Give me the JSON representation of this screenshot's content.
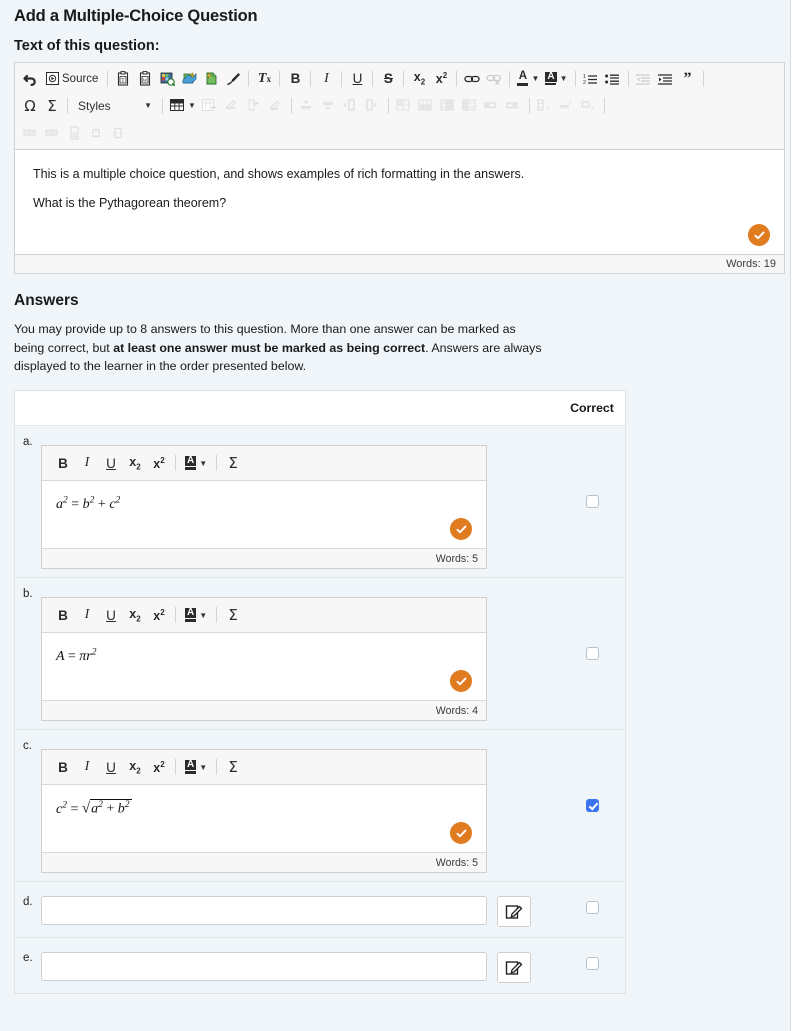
{
  "header": {
    "title": "Add a Multiple-Choice Question",
    "question_label": "Text of this question:"
  },
  "main_editor": {
    "toolbar_rows": [
      [
        {
          "name": "undo-icon",
          "glyph": "undo",
          "label": "",
          "dim": false
        },
        {
          "name": "source-button",
          "glyph": "source",
          "label": "Source",
          "dim": false
        },
        {
          "name": "sep",
          "glyph": "sep"
        },
        {
          "name": "paste-text-icon",
          "glyph": "paste-text",
          "dim": false
        },
        {
          "name": "paste-word-icon",
          "glyph": "paste-word",
          "dim": false
        },
        {
          "name": "insert-image-icon",
          "glyph": "image",
          "dim": false
        },
        {
          "name": "insert-media-icon",
          "glyph": "media",
          "dim": false
        },
        {
          "name": "insert-file-icon",
          "glyph": "file",
          "dim": false
        },
        {
          "name": "format-painter-icon",
          "glyph": "brush",
          "dim": false
        },
        {
          "name": "sep",
          "glyph": "sep"
        },
        {
          "name": "remove-format-icon",
          "glyph": "Tx",
          "dim": false
        },
        {
          "name": "sep",
          "glyph": "sep"
        },
        {
          "name": "bold-icon",
          "glyph": "B",
          "dim": false
        },
        {
          "name": "sep",
          "glyph": "sep"
        },
        {
          "name": "italic-icon",
          "glyph": "I",
          "dim": false
        },
        {
          "name": "sep",
          "glyph": "sep"
        },
        {
          "name": "underline-icon",
          "glyph": "U",
          "dim": false
        },
        {
          "name": "sep",
          "glyph": "sep"
        },
        {
          "name": "strikethrough-icon",
          "glyph": "S",
          "dim": false
        },
        {
          "name": "sep",
          "glyph": "sep"
        },
        {
          "name": "subscript-icon",
          "glyph": "x2sub",
          "dim": false
        },
        {
          "name": "superscript-icon",
          "glyph": "x2sup",
          "dim": false
        },
        {
          "name": "sep",
          "glyph": "sep"
        },
        {
          "name": "link-icon",
          "glyph": "link",
          "dim": false
        },
        {
          "name": "unlink-icon",
          "glyph": "unlink",
          "dim": true
        },
        {
          "name": "sep",
          "glyph": "sep"
        },
        {
          "name": "text-color-icon",
          "glyph": "text-color",
          "dim": false
        },
        {
          "name": "background-color-icon",
          "glyph": "bg-color",
          "dim": false
        },
        {
          "name": "sep",
          "glyph": "sep"
        },
        {
          "name": "numbered-list-icon",
          "glyph": "ol",
          "dim": false
        },
        {
          "name": "bulleted-list-icon",
          "glyph": "ul",
          "dim": false
        },
        {
          "name": "sep",
          "glyph": "sep"
        },
        {
          "name": "decrease-indent-icon",
          "glyph": "outdent",
          "dim": true
        },
        {
          "name": "increase-indent-icon",
          "glyph": "indent",
          "dim": false
        },
        {
          "name": "blockquote-icon",
          "glyph": "quote",
          "dim": false
        },
        {
          "name": "sep",
          "glyph": "sep"
        }
      ],
      [
        {
          "name": "special-character-icon",
          "glyph": "omega",
          "dim": false
        },
        {
          "name": "insert-equation-icon",
          "glyph": "sigma",
          "dim": false
        },
        {
          "name": "sep",
          "glyph": "sep"
        },
        {
          "name": "styles-dropdown",
          "glyph": "styles",
          "label": "Styles",
          "dim": false
        },
        {
          "name": "sep",
          "glyph": "sep"
        },
        {
          "name": "insert-table-icon",
          "glyph": "table",
          "dim": false
        },
        {
          "name": "table-properties-icon",
          "glyph": "tbl-prop",
          "dim": true
        },
        {
          "name": "delete-table-icon",
          "glyph": "tbl-del",
          "dim": true
        },
        {
          "name": "cell-properties-icon",
          "glyph": "cell-prop",
          "dim": true
        },
        {
          "name": "delete-cell-icon",
          "glyph": "cell-del",
          "dim": true
        },
        {
          "name": "sep",
          "glyph": "sep"
        },
        {
          "name": "insert-row-before-icon",
          "glyph": "row-before",
          "dim": true
        },
        {
          "name": "insert-row-after-icon",
          "glyph": "row-after",
          "dim": true
        },
        {
          "name": "insert-column-left-icon",
          "glyph": "col-left",
          "dim": true
        },
        {
          "name": "insert-column-right-icon",
          "glyph": "col-right",
          "dim": true
        },
        {
          "name": "sep",
          "glyph": "sep"
        },
        {
          "name": "merge-cells-icon",
          "glyph": "merge1",
          "dim": true
        },
        {
          "name": "merge-right-icon",
          "glyph": "merge2",
          "dim": true
        },
        {
          "name": "merge-down-icon",
          "glyph": "merge3",
          "dim": true
        },
        {
          "name": "split-cell-icon",
          "glyph": "merge4",
          "dim": true
        },
        {
          "name": "insert-caption-icon",
          "glyph": "cap1",
          "dim": true
        },
        {
          "name": "insert-summary-icon",
          "glyph": "cap2",
          "dim": true
        },
        {
          "name": "sep",
          "glyph": "sep"
        },
        {
          "name": "delete-row-icon",
          "glyph": "del-row",
          "dim": true
        },
        {
          "name": "delete-column-icon",
          "glyph": "del-col",
          "dim": true
        },
        {
          "name": "delete-cell2-icon",
          "glyph": "del-cell",
          "dim": true
        },
        {
          "name": "sep",
          "glyph": "sep"
        }
      ],
      [
        {
          "name": "split-cell-horizontal-icon",
          "glyph": "sp-h",
          "dim": true
        },
        {
          "name": "split-cell-vertical-icon",
          "glyph": "sp-v",
          "dim": true
        },
        {
          "name": "cell-height-icon",
          "glyph": "cell-h",
          "dim": true
        },
        {
          "name": "align-cell-center-icon",
          "glyph": "al-c",
          "dim": true
        },
        {
          "name": "align-cell-middle-icon",
          "glyph": "al-m",
          "dim": true
        }
      ]
    ],
    "source_label": "Source",
    "styles_label": "Styles",
    "paragraphs": [
      "This is a multiple choice question, and shows examples of rich formatting in the answers.",
      "What is the Pythagorean theorem?"
    ],
    "word_count": "Words: 19",
    "accessibility_badge": "accessibility-check-icon"
  },
  "answers": {
    "heading": "Answers",
    "description_part1": "You may provide up to 8 answers to this question. More than one answer can be marked as being correct, but ",
    "description_bold": "at least one answer must be marked as being correct",
    "description_part2": ". Answers are always displayed to the learner in the order presented below.",
    "correct_column_header": "Correct",
    "mini_toolbar": [
      {
        "name": "bold-icon",
        "glyph": "B"
      },
      {
        "name": "italic-icon",
        "glyph": "I"
      },
      {
        "name": "underline-icon",
        "glyph": "U"
      },
      {
        "name": "subscript-icon",
        "glyph": "x2sub"
      },
      {
        "name": "superscript-icon",
        "glyph": "x2sup"
      },
      {
        "name": "sep",
        "glyph": "sep"
      },
      {
        "name": "background-color-icon",
        "glyph": "bg-color"
      },
      {
        "name": "sep",
        "glyph": "sep"
      },
      {
        "name": "insert-equation-icon",
        "glyph": "sigma"
      }
    ],
    "rows": [
      {
        "letter": "a.",
        "type": "editor",
        "formula_html": "<span class=\"math\"><i>a</i><sup>2</sup> <span class=\"op\">=</span> <i>b</i><sup>2</sup> <span class=\"op\">+</span> <i>c</i><sup>2</sup></span>",
        "word_count": "Words: 5",
        "correct": false,
        "accessibility_badge": "accessibility-check-icon"
      },
      {
        "letter": "b.",
        "type": "editor",
        "formula_html": "<span class=\"math\"><i>A</i> <span class=\"op\">=</span> <i>&pi;r</i><sup>2</sup></span>",
        "word_count": "Words: 4",
        "correct": false,
        "accessibility_badge": "accessibility-check-icon"
      },
      {
        "letter": "c.",
        "type": "editor",
        "formula_html": "<span class=\"math\"><i>c</i><sup>2</sup> <span class=\"op\">=</span> <span class=\"sqrt\"><span class=\"radsign\">&radic;</span><span class=\"radicand\"><i>a</i><sup>2</sup> <span class=\"op\">+</span> <i>b</i><sup>2</sup></span></span></span>",
        "word_count": "Words: 5",
        "correct": true,
        "accessibility_badge": "accessibility-check-icon"
      },
      {
        "letter": "d.",
        "type": "input",
        "value": "",
        "placeholder": "",
        "edit_button": "open-editor-icon",
        "correct": false
      },
      {
        "letter": "e.",
        "type": "input",
        "value": "",
        "placeholder": "",
        "edit_button": "open-editor-icon",
        "correct": false
      }
    ]
  },
  "colors": {
    "page_background": "#eff5f8",
    "accent_orange": "#e07b1f",
    "checkbox_blue": "#3b74f0",
    "panel_white": "#ffffff",
    "border_grey": "#d1d1d1"
  }
}
